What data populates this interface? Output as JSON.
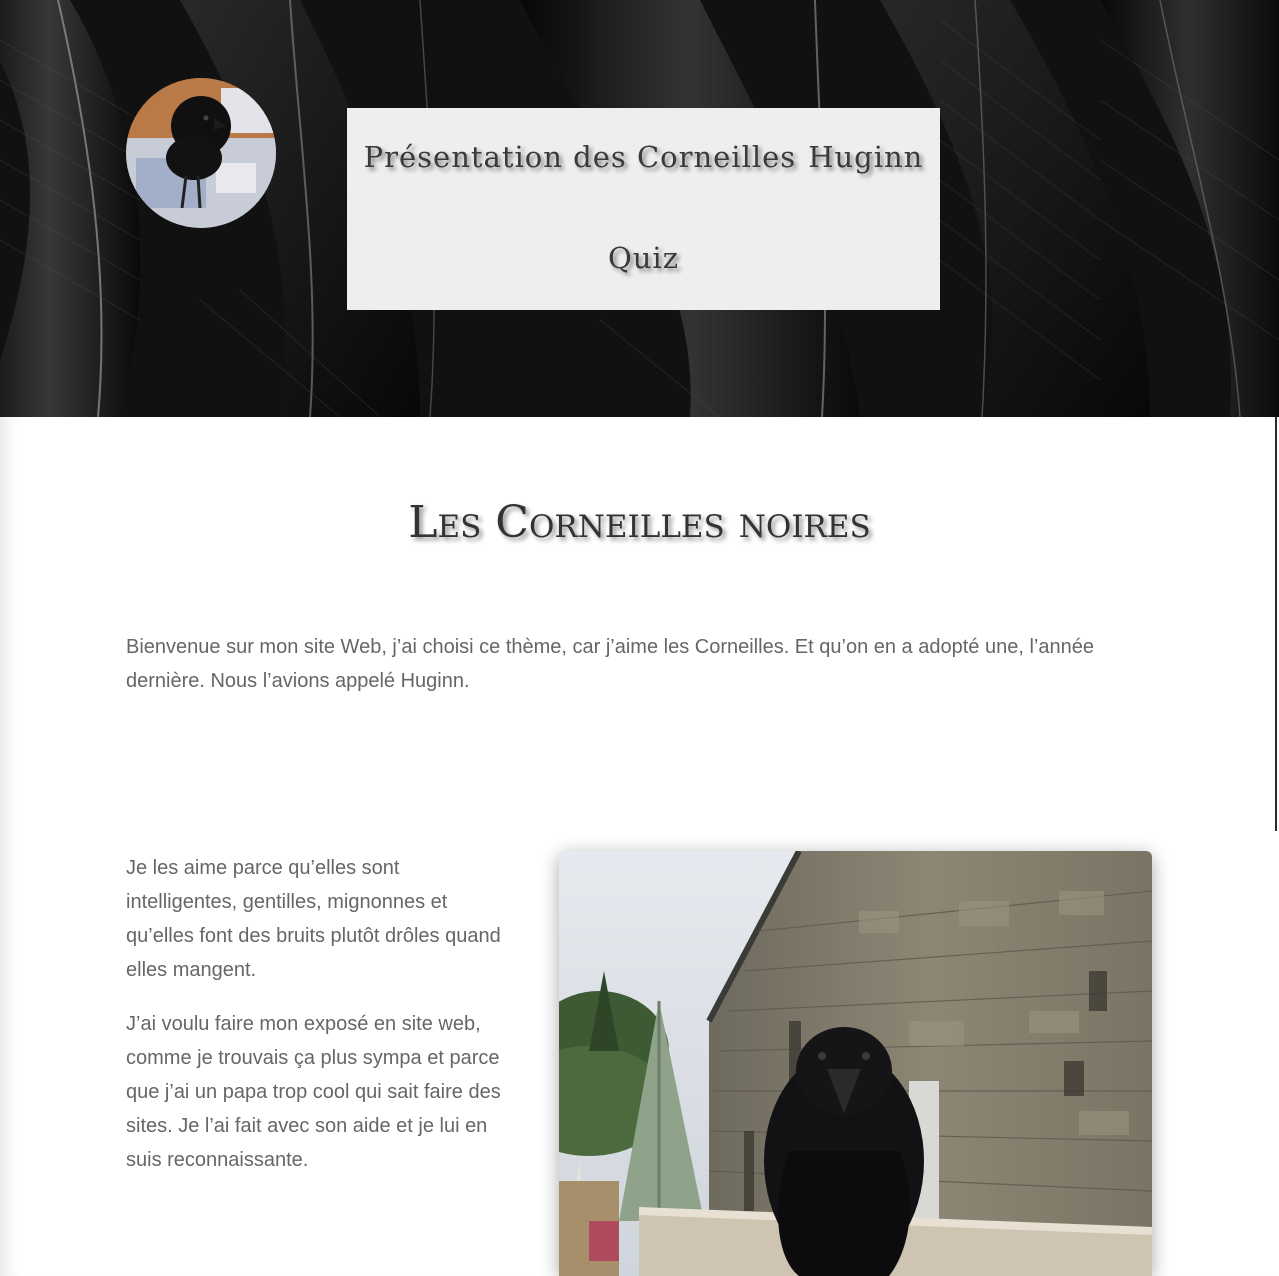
{
  "header": {
    "avatar_alt": "Huginn avatar",
    "nav": {
      "link_presentation": "Présentation des Corneilles",
      "link_huginn": "Huginn",
      "link_quiz": "Quiz"
    }
  },
  "main": {
    "title": "Les Corneilles noires",
    "intro": "Bienvenue sur mon site Web, j’ai choisi ce thème, car j’aime les Corneilles. Et qu’on en a adopté une, l’année dernière. Nous l’avions appelé Huginn.",
    "paragraphs": [
      "Je les aime parce qu’elles sont intelligentes, gentilles, mignonnes et qu’elles font des bruits plutôt drôles quand elles mangent.",
      "J’ai voulu faire mon exposé en site web, comme je trouvais ça plus sympa et parce que j’ai un papa trop cool qui sait faire des sites. Je l’ai fait avec son aide et je lui en suis reconnaissante."
    ],
    "photo_subject": "crow-on-railing"
  },
  "colors": {
    "nav_box": "#eeeeee",
    "nav_text": "#3a3a3a",
    "body_text": "#666666",
    "title_text": "#333333",
    "hero_dark": "#0c0c0c"
  }
}
